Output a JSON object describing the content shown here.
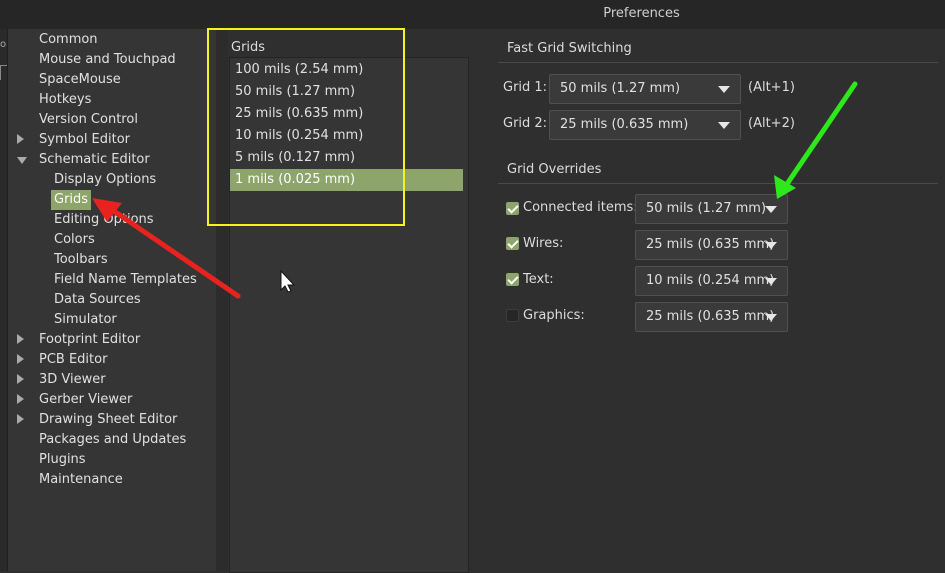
{
  "window": {
    "title": "Preferences",
    "left_marks": [
      "o"
    ]
  },
  "sidebar": {
    "items": [
      {
        "label": "Common",
        "level": 0,
        "expander": "none"
      },
      {
        "label": "Mouse and Touchpad",
        "level": 0,
        "expander": "none"
      },
      {
        "label": "SpaceMouse",
        "level": 0,
        "expander": "none"
      },
      {
        "label": "Hotkeys",
        "level": 0,
        "expander": "none"
      },
      {
        "label": "Version Control",
        "level": 0,
        "expander": "none"
      },
      {
        "label": "Symbol Editor",
        "level": 0,
        "expander": "collapsed"
      },
      {
        "label": "Schematic Editor",
        "level": 0,
        "expander": "expanded"
      },
      {
        "label": "Display Options",
        "level": 1,
        "expander": "none"
      },
      {
        "label": "Grids",
        "level": 1,
        "expander": "none",
        "selected": true
      },
      {
        "label": "Editing Options",
        "level": 1,
        "expander": "none"
      },
      {
        "label": "Colors",
        "level": 1,
        "expander": "none"
      },
      {
        "label": "Toolbars",
        "level": 1,
        "expander": "none"
      },
      {
        "label": "Field Name Templates",
        "level": 1,
        "expander": "none"
      },
      {
        "label": "Data Sources",
        "level": 1,
        "expander": "none"
      },
      {
        "label": "Simulator",
        "level": 1,
        "expander": "none"
      },
      {
        "label": "Footprint Editor",
        "level": 0,
        "expander": "collapsed"
      },
      {
        "label": "PCB Editor",
        "level": 0,
        "expander": "collapsed"
      },
      {
        "label": "3D Viewer",
        "level": 0,
        "expander": "collapsed"
      },
      {
        "label": "Gerber Viewer",
        "level": 0,
        "expander": "collapsed"
      },
      {
        "label": "Drawing Sheet Editor",
        "level": 0,
        "expander": "collapsed"
      },
      {
        "label": "Packages and Updates",
        "level": 0,
        "expander": "none"
      },
      {
        "label": "Plugins",
        "level": 0,
        "expander": "none"
      },
      {
        "label": "Maintenance",
        "level": 0,
        "expander": "none"
      }
    ]
  },
  "grids": {
    "label": "Grids",
    "items": [
      {
        "label": "100 mils (2.54 mm)"
      },
      {
        "label": "50 mils (1.27 mm)"
      },
      {
        "label": "25 mils (0.635 mm)"
      },
      {
        "label": "10 mils (0.254 mm)"
      },
      {
        "label": "5 mils (0.127 mm)"
      },
      {
        "label": "1 mils (0.025 mm)",
        "selected": true
      }
    ]
  },
  "fast_grid": {
    "title": "Fast Grid Switching",
    "grid1": {
      "label": "Grid 1:",
      "value": "50 mils (1.27 mm)",
      "hotkey": "(Alt+1)"
    },
    "grid2": {
      "label": "Grid 2:",
      "value": "25 mils (0.635 mm)",
      "hotkey": "(Alt+2)"
    }
  },
  "overrides": {
    "title": "Grid Overrides",
    "rows": [
      {
        "label": "Connected items:",
        "checked": true,
        "value": "50 mils (1.27 mm)"
      },
      {
        "label": "Wires:",
        "checked": true,
        "value": "25 mils (0.635 mm)"
      },
      {
        "label": "Text:",
        "checked": true,
        "value": "10 mils (0.254 mm)"
      },
      {
        "label": "Graphics:",
        "checked": false,
        "value": "25 mils (0.635 mm)"
      }
    ]
  },
  "annotations": {
    "highlight_color": "#f4f21f",
    "red_arrow_color": "#e8231f",
    "green_arrow_color": "#2ee81c"
  },
  "colors": {
    "accent": "#8da46a",
    "background": "#2f2f2f",
    "panel": "#353535"
  }
}
